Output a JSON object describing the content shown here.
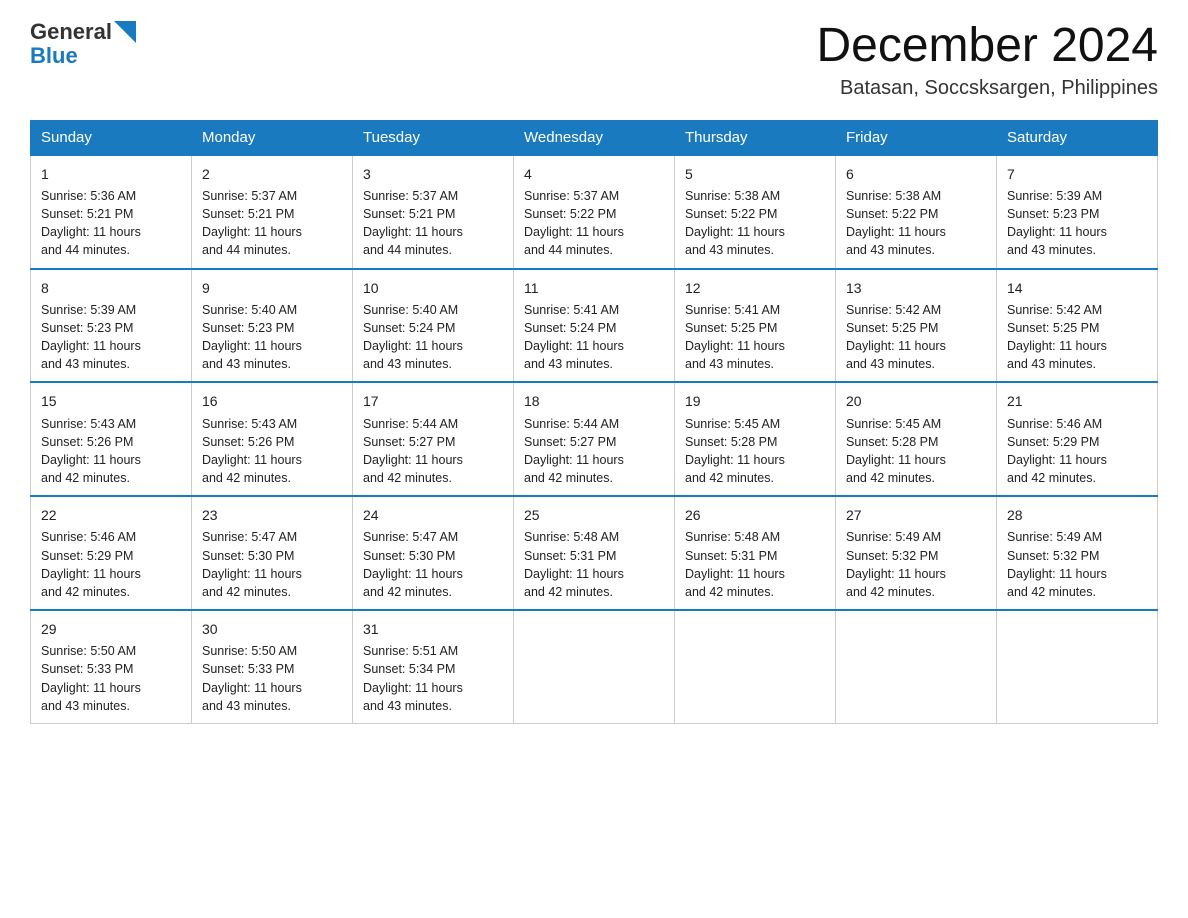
{
  "header": {
    "logo_general": "General",
    "logo_blue": "Blue",
    "month_title": "December 2024",
    "location": "Batasan, Soccsksargen, Philippines"
  },
  "days_of_week": [
    "Sunday",
    "Monday",
    "Tuesday",
    "Wednesday",
    "Thursday",
    "Friday",
    "Saturday"
  ],
  "weeks": [
    [
      {
        "day": "1",
        "sunrise": "5:36 AM",
        "sunset": "5:21 PM",
        "daylight": "11 hours and 44 minutes."
      },
      {
        "day": "2",
        "sunrise": "5:37 AM",
        "sunset": "5:21 PM",
        "daylight": "11 hours and 44 minutes."
      },
      {
        "day": "3",
        "sunrise": "5:37 AM",
        "sunset": "5:21 PM",
        "daylight": "11 hours and 44 minutes."
      },
      {
        "day": "4",
        "sunrise": "5:37 AM",
        "sunset": "5:22 PM",
        "daylight": "11 hours and 44 minutes."
      },
      {
        "day": "5",
        "sunrise": "5:38 AM",
        "sunset": "5:22 PM",
        "daylight": "11 hours and 43 minutes."
      },
      {
        "day": "6",
        "sunrise": "5:38 AM",
        "sunset": "5:22 PM",
        "daylight": "11 hours and 43 minutes."
      },
      {
        "day": "7",
        "sunrise": "5:39 AM",
        "sunset": "5:23 PM",
        "daylight": "11 hours and 43 minutes."
      }
    ],
    [
      {
        "day": "8",
        "sunrise": "5:39 AM",
        "sunset": "5:23 PM",
        "daylight": "11 hours and 43 minutes."
      },
      {
        "day": "9",
        "sunrise": "5:40 AM",
        "sunset": "5:23 PM",
        "daylight": "11 hours and 43 minutes."
      },
      {
        "day": "10",
        "sunrise": "5:40 AM",
        "sunset": "5:24 PM",
        "daylight": "11 hours and 43 minutes."
      },
      {
        "day": "11",
        "sunrise": "5:41 AM",
        "sunset": "5:24 PM",
        "daylight": "11 hours and 43 minutes."
      },
      {
        "day": "12",
        "sunrise": "5:41 AM",
        "sunset": "5:25 PM",
        "daylight": "11 hours and 43 minutes."
      },
      {
        "day": "13",
        "sunrise": "5:42 AM",
        "sunset": "5:25 PM",
        "daylight": "11 hours and 43 minutes."
      },
      {
        "day": "14",
        "sunrise": "5:42 AM",
        "sunset": "5:25 PM",
        "daylight": "11 hours and 43 minutes."
      }
    ],
    [
      {
        "day": "15",
        "sunrise": "5:43 AM",
        "sunset": "5:26 PM",
        "daylight": "11 hours and 42 minutes."
      },
      {
        "day": "16",
        "sunrise": "5:43 AM",
        "sunset": "5:26 PM",
        "daylight": "11 hours and 42 minutes."
      },
      {
        "day": "17",
        "sunrise": "5:44 AM",
        "sunset": "5:27 PM",
        "daylight": "11 hours and 42 minutes."
      },
      {
        "day": "18",
        "sunrise": "5:44 AM",
        "sunset": "5:27 PM",
        "daylight": "11 hours and 42 minutes."
      },
      {
        "day": "19",
        "sunrise": "5:45 AM",
        "sunset": "5:28 PM",
        "daylight": "11 hours and 42 minutes."
      },
      {
        "day": "20",
        "sunrise": "5:45 AM",
        "sunset": "5:28 PM",
        "daylight": "11 hours and 42 minutes."
      },
      {
        "day": "21",
        "sunrise": "5:46 AM",
        "sunset": "5:29 PM",
        "daylight": "11 hours and 42 minutes."
      }
    ],
    [
      {
        "day": "22",
        "sunrise": "5:46 AM",
        "sunset": "5:29 PM",
        "daylight": "11 hours and 42 minutes."
      },
      {
        "day": "23",
        "sunrise": "5:47 AM",
        "sunset": "5:30 PM",
        "daylight": "11 hours and 42 minutes."
      },
      {
        "day": "24",
        "sunrise": "5:47 AM",
        "sunset": "5:30 PM",
        "daylight": "11 hours and 42 minutes."
      },
      {
        "day": "25",
        "sunrise": "5:48 AM",
        "sunset": "5:31 PM",
        "daylight": "11 hours and 42 minutes."
      },
      {
        "day": "26",
        "sunrise": "5:48 AM",
        "sunset": "5:31 PM",
        "daylight": "11 hours and 42 minutes."
      },
      {
        "day": "27",
        "sunrise": "5:49 AM",
        "sunset": "5:32 PM",
        "daylight": "11 hours and 42 minutes."
      },
      {
        "day": "28",
        "sunrise": "5:49 AM",
        "sunset": "5:32 PM",
        "daylight": "11 hours and 42 minutes."
      }
    ],
    [
      {
        "day": "29",
        "sunrise": "5:50 AM",
        "sunset": "5:33 PM",
        "daylight": "11 hours and 43 minutes."
      },
      {
        "day": "30",
        "sunrise": "5:50 AM",
        "sunset": "5:33 PM",
        "daylight": "11 hours and 43 minutes."
      },
      {
        "day": "31",
        "sunrise": "5:51 AM",
        "sunset": "5:34 PM",
        "daylight": "11 hours and 43 minutes."
      },
      null,
      null,
      null,
      null
    ]
  ],
  "labels": {
    "sunrise": "Sunrise:",
    "sunset": "Sunset:",
    "daylight": "Daylight:"
  }
}
